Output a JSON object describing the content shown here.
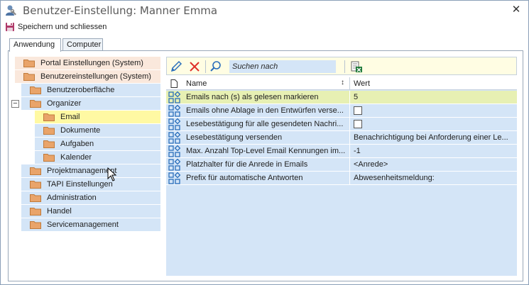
{
  "window": {
    "title": "Benutzer-Einstellung: Manner Emma",
    "close_symbol": "✕"
  },
  "toolbar": {
    "save_label": "Speichern und schliessen"
  },
  "tabs": [
    {
      "label": "Anwendung",
      "active": true
    },
    {
      "label": "Computer",
      "active": false
    }
  ],
  "tree": {
    "expander_symbol": "−",
    "items": [
      {
        "label": "Portal Einstellungen (System)",
        "level": 0
      },
      {
        "label": "Benutzereinstellungen (System)",
        "level": 0
      },
      {
        "label": "Benutzeroberfläche",
        "level": 1
      },
      {
        "label": "Organizer",
        "level": 1
      },
      {
        "label": "Email",
        "level": 2,
        "selected": true
      },
      {
        "label": "Dokumente",
        "level": 2
      },
      {
        "label": "Aufgaben",
        "level": 2
      },
      {
        "label": "Kalender",
        "level": 2
      },
      {
        "label": "Projektmanagement",
        "level": 1
      },
      {
        "label": "TAPI Einstellungen",
        "level": 1
      },
      {
        "label": "Administration",
        "level": 1
      },
      {
        "label": "Handel",
        "level": 1
      },
      {
        "label": "Servicemanagement",
        "level": 1
      }
    ]
  },
  "search": {
    "placeholder": "Suchen nach"
  },
  "grid": {
    "header_name": "Name",
    "header_value": "Wert",
    "sort_symbol": "↕",
    "rows": [
      {
        "name": "Emails nach (s) als gelesen markieren",
        "value": "5",
        "type": "text",
        "selected": true
      },
      {
        "name": "Emails ohne Ablage in den Entwürfen verse...",
        "value": "",
        "type": "checkbox"
      },
      {
        "name": "Lesebestätigung für alle gesendeten Nachri...",
        "value": "",
        "type": "checkbox"
      },
      {
        "name": "Lesebestätigung versenden",
        "value": "Benachrichtigung bei Anforderung einer Le...",
        "type": "text"
      },
      {
        "name": "Max. Anzahl Top-Level Email Kennungen im...",
        "value": "-1",
        "type": "text"
      },
      {
        "name": "Platzhalter für die Anrede in Emails",
        "value": "<Anrede>",
        "type": "text"
      },
      {
        "name": "Prefix für automatische Antworten",
        "value": "Abwesenheitsmeldung:",
        "type": "text"
      }
    ]
  },
  "colors": {
    "folder": "#e9a46a",
    "tree_row": "#d4e5f7",
    "selected": "#fff9a3",
    "top_row": "#fae8dc",
    "accent": "#2a6ebb"
  }
}
